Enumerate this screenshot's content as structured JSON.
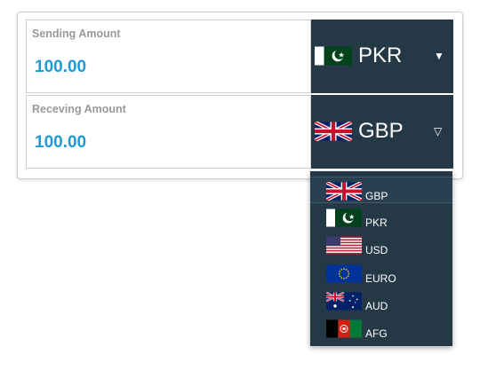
{
  "sending": {
    "label": "Sending Amount",
    "value": "100.00",
    "currency": "PKR",
    "flag": "pakistan-flag",
    "caret": "▼"
  },
  "receiving": {
    "label": "Receving Amount",
    "value": "100.00",
    "currency": "GBP",
    "flag": "uk-flag",
    "caret": "▽"
  },
  "dropdown": {
    "options": [
      {
        "code": "GBP",
        "flag": "uk-flag",
        "selected": true
      },
      {
        "code": "PKR",
        "flag": "pakistan-flag"
      },
      {
        "code": "USD",
        "flag": "usa-flag"
      },
      {
        "code": "EURO",
        "flag": "eu-flag"
      },
      {
        "code": "AUD",
        "flag": "australia-flag"
      },
      {
        "code": "AFG",
        "flag": "afghanistan-flag"
      }
    ]
  },
  "colors": {
    "selector_bg": "#253846",
    "amount_text": "#1f9ad6",
    "label_text": "#9a9a9a"
  }
}
